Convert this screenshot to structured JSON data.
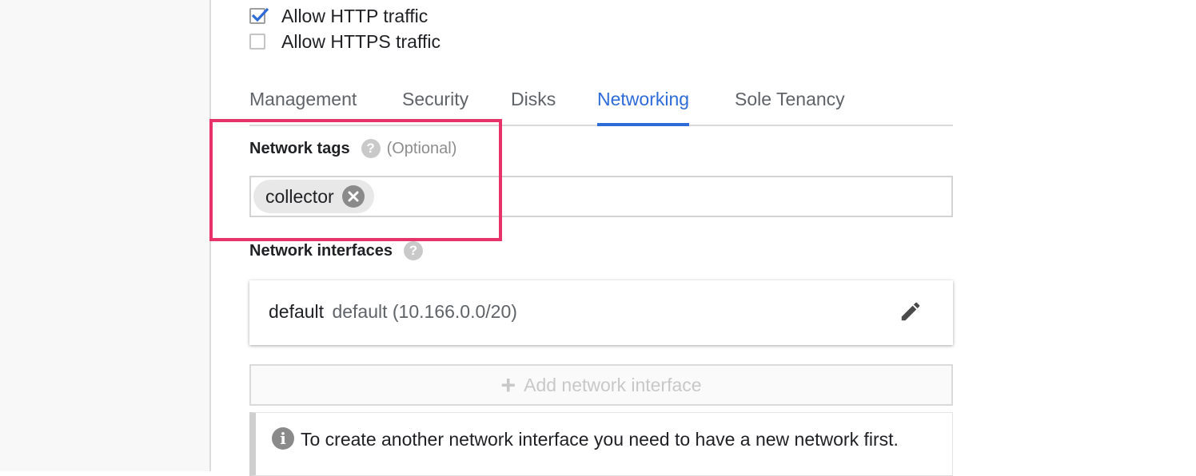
{
  "firewall": {
    "http_label": "Allow HTTP traffic",
    "http_checked": true,
    "https_label": "Allow HTTPS traffic",
    "https_checked": false
  },
  "tabs": [
    {
      "label": "Management",
      "active": false
    },
    {
      "label": "Security",
      "active": false
    },
    {
      "label": "Disks",
      "active": false
    },
    {
      "label": "Networking",
      "active": true
    },
    {
      "label": "Sole Tenancy",
      "active": false
    }
  ],
  "network_tags": {
    "label": "Network tags",
    "help": "?",
    "optional": "(Optional)",
    "chips": [
      {
        "label": "collector"
      }
    ]
  },
  "network_interfaces": {
    "label": "Network interfaces",
    "help": "?",
    "items": [
      {
        "name": "default",
        "detail": "default (10.166.0.0/20)"
      }
    ],
    "add_label": "Add network interface",
    "info_text": "To create another network interface you need to have a new network first."
  },
  "colors": {
    "accent": "#2d6bd7",
    "highlight": "#e8336a"
  },
  "icons": {
    "checkbox_check": "check-icon",
    "help": "help-circle-icon",
    "chip_remove": "close-circle-icon",
    "edit": "pencil-icon",
    "add": "plus-icon",
    "info": "info-icon"
  }
}
